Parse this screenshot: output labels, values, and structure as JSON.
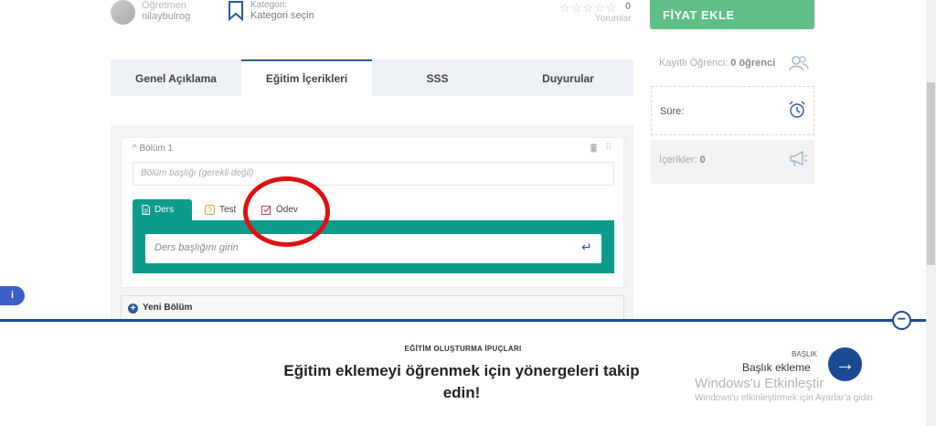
{
  "header": {
    "teacher_role": "Öğretmen",
    "teacher_name": "nilaybulrog",
    "category_label": "Kategori:",
    "category_value": "Kategori seçin",
    "stars": "☆☆☆☆☆",
    "rating": "0",
    "reviews_label": "Yorumlar",
    "price_button": "FİYAT EKLE"
  },
  "sidebar": {
    "enrolled_label": "Kayıtlı Öğrenci:",
    "enrolled_value": "0 öğrenci",
    "duration_label": "Süre:",
    "contents_label": "İçerikler:",
    "contents_value": "0"
  },
  "tabs": [
    {
      "label": "Genel Açıklama"
    },
    {
      "label": "Eğitim İçerikleri"
    },
    {
      "label": "SSS"
    },
    {
      "label": "Duyurular"
    }
  ],
  "builder": {
    "section_title": "Bölüm 1",
    "section_placeholder": "Bölüm başlığı (gerekli değil)",
    "subtabs": {
      "ders": "Ders",
      "test": "Test",
      "odev": "Ödev"
    },
    "ders_placeholder": "Ders başlığını girin",
    "new_section": "Yeni Bölüm"
  },
  "tips": {
    "kicker": "EĞİTİM OLUŞTURMA İPUÇLARI",
    "main": "Eğitim eklemeyi öğrenmek için yönergeleri takip edin!",
    "next_kicker": "BAŞLIK",
    "next_title": "Başlık ekleme"
  },
  "watermark": {
    "title": "Windows'u Etkinleştir",
    "subtitle": "Windows'u etkinleştirmek için Ayarlar'a gidin."
  },
  "colors": {
    "teal": "#0e9b8c",
    "green": "#5fbf86",
    "navy": "#1a4a92",
    "red_highlight": "#e01010"
  }
}
